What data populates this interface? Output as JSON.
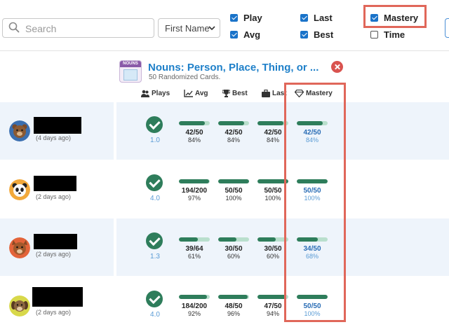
{
  "toolbar": {
    "search_placeholder": "Search",
    "sort_select": "First Name",
    "checkboxes": [
      {
        "label": "Play",
        "checked": true
      },
      {
        "label": "Avg",
        "checked": true
      },
      {
        "label": "Last",
        "checked": true
      },
      {
        "label": "Best",
        "checked": true
      },
      {
        "label": "Mastery",
        "checked": true
      },
      {
        "label": "Time",
        "checked": false
      }
    ]
  },
  "deck": {
    "title": "Nouns: Person, Place, Thing, or ...",
    "subtitle": "50 Randomized Cards.",
    "thumb_label": "NOUNS"
  },
  "columns": {
    "plays": "Plays",
    "avg": "Avg",
    "best": "Best",
    "last": "Last",
    "mastery": "Mastery"
  },
  "colors": {
    "accent_blue": "#1f80c9",
    "green": "#2e7d5b",
    "light_green": "#b9dfcd",
    "highlight_red": "#e0675a",
    "close_red": "#d9534f"
  },
  "rows": [
    {
      "ago": "(4 days ago)",
      "avatar": "bear",
      "plays": "1.0",
      "stats": [
        {
          "frac": "42/50",
          "pct": "84%",
          "value": 0.84
        },
        {
          "frac": "42/50",
          "pct": "84%",
          "value": 0.84
        },
        {
          "frac": "42/50",
          "pct": "84%",
          "value": 0.84
        },
        {
          "frac": "42/50",
          "pct": "84%",
          "value": 0.84
        }
      ]
    },
    {
      "ago": "(2 days ago)",
      "avatar": "panda",
      "plays": "4.0",
      "stats": [
        {
          "frac": "194/200",
          "pct": "97%",
          "value": 0.97
        },
        {
          "frac": "50/50",
          "pct": "100%",
          "value": 1.0
        },
        {
          "frac": "50/50",
          "pct": "100%",
          "value": 1.0
        },
        {
          "frac": "50/50",
          "pct": "100%",
          "value": 1.0
        }
      ]
    },
    {
      "ago": "(2 days ago)",
      "avatar": "squirrel",
      "plays": "1.3",
      "stats": [
        {
          "frac": "39/64",
          "pct": "61%",
          "value": 0.61
        },
        {
          "frac": "30/50",
          "pct": "60%",
          "value": 0.6
        },
        {
          "frac": "30/50",
          "pct": "60%",
          "value": 0.6
        },
        {
          "frac": "34/50",
          "pct": "68%",
          "value": 0.68
        }
      ]
    },
    {
      "ago": "(2 days ago)",
      "avatar": "dog",
      "plays": "4.0",
      "stats": [
        {
          "frac": "184/200",
          "pct": "92%",
          "value": 0.92
        },
        {
          "frac": "48/50",
          "pct": "96%",
          "value": 0.96
        },
        {
          "frac": "47/50",
          "pct": "94%",
          "value": 0.94
        },
        {
          "frac": "50/50",
          "pct": "100%",
          "value": 1.0
        }
      ]
    }
  ]
}
